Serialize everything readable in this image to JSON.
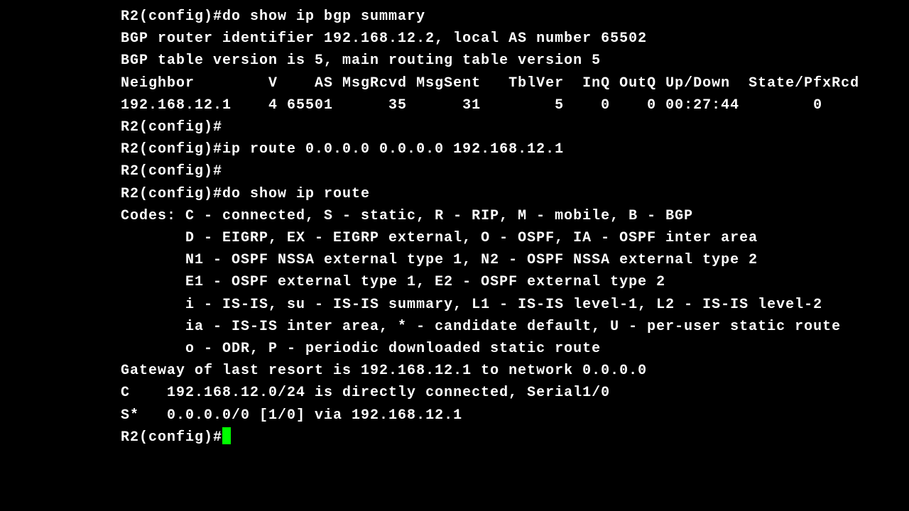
{
  "lines": [
    "R2(config)#do show ip bgp summary",
    "BGP router identifier 192.168.12.2, local AS number 65502",
    "BGP table version is 5, main routing table version 5",
    "",
    "Neighbor        V    AS MsgRcvd MsgSent   TblVer  InQ OutQ Up/Down  State/PfxRcd",
    "192.168.12.1    4 65501      35      31        5    0    0 00:27:44        0",
    "R2(config)#",
    "R2(config)#ip route 0.0.0.0 0.0.0.0 192.168.12.1",
    "R2(config)#",
    "R2(config)#do show ip route",
    "Codes: C - connected, S - static, R - RIP, M - mobile, B - BGP",
    "       D - EIGRP, EX - EIGRP external, O - OSPF, IA - OSPF inter area",
    "       N1 - OSPF NSSA external type 1, N2 - OSPF NSSA external type 2",
    "       E1 - OSPF external type 1, E2 - OSPF external type 2",
    "       i - IS-IS, su - IS-IS summary, L1 - IS-IS level-1, L2 - IS-IS level-2",
    "       ia - IS-IS inter area, * - candidate default, U - per-user static route",
    "       o - ODR, P - periodic downloaded static route",
    "",
    "Gateway of last resort is 192.168.12.1 to network 0.0.0.0",
    "",
    "C    192.168.12.0/24 is directly connected, Serial1/0",
    "S*   0.0.0.0/0 [1/0] via 192.168.12.1"
  ],
  "prompt": "R2(config)#"
}
